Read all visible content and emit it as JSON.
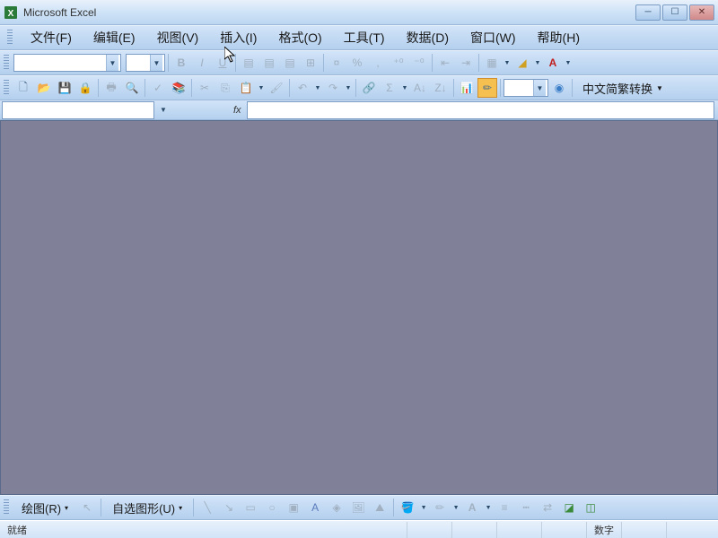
{
  "window": {
    "title": "Microsoft Excel"
  },
  "menu": {
    "file": "文件(F)",
    "edit": "编辑(E)",
    "view": "视图(V)",
    "insert": "插入(I)",
    "format": "格式(O)",
    "tools": "工具(T)",
    "data": "数据(D)",
    "window": "窗口(W)",
    "help": "帮助(H)"
  },
  "toolbar2": {
    "chinese_convert": "中文简繁转换"
  },
  "formula": {
    "fx": "fx"
  },
  "drawing": {
    "draw": "绘图(R)",
    "autoshapes": "自选图形(U)"
  },
  "status": {
    "ready": "就绪",
    "num": "数字"
  }
}
